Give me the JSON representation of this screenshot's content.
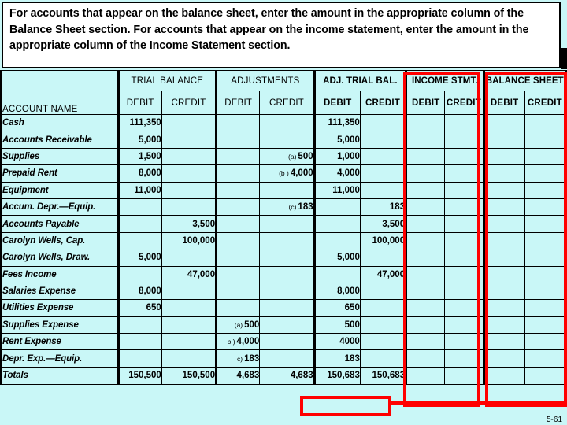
{
  "banner": {
    "text": "For accounts that appear on the balance sheet, enter the amount in the appropriate column of the Balance Sheet section. For accounts that appear on the income statement, enter the amount in the appropriate column of the Income Statement section."
  },
  "worksheet": {
    "account_name_header": "ACCOUNT NAME",
    "groups": [
      {
        "label": "TRIAL BALANCE",
        "bold": false
      },
      {
        "label": "ADJUSTMENTS",
        "bold": false
      },
      {
        "label": "ADJ. TRIAL BAL.",
        "bold": true
      },
      {
        "label": "INCOME STMT.",
        "bold": true
      },
      {
        "label": "BALANCE SHEET",
        "bold": true
      }
    ],
    "sub_headers": {
      "debit": "DEBIT",
      "credit": "CREDIT"
    },
    "rows": [
      {
        "account": "Cash",
        "tb_debit": "111,350",
        "tb_credit": "",
        "adj_debit": "",
        "adj_debit_ref": "",
        "adj_credit": "",
        "adj_credit_ref": "",
        "atb_debit": "111,350",
        "atb_credit": "",
        "is_debit": "",
        "is_credit": "",
        "bs_debit": "",
        "bs_credit": ""
      },
      {
        "account": "Accounts Receivable",
        "tb_debit": "5,000",
        "tb_credit": "",
        "adj_debit": "",
        "adj_debit_ref": "",
        "adj_credit": "",
        "adj_credit_ref": "",
        "atb_debit": "5,000",
        "atb_credit": "",
        "is_debit": "",
        "is_credit": "",
        "bs_debit": "",
        "bs_credit": ""
      },
      {
        "account": "Supplies",
        "tb_debit": "1,500",
        "tb_credit": "",
        "adj_debit": "",
        "adj_debit_ref": "",
        "adj_credit": "500",
        "adj_credit_ref": "(a)",
        "atb_debit": "1,000",
        "atb_credit": "",
        "is_debit": "",
        "is_credit": "",
        "bs_debit": "",
        "bs_credit": ""
      },
      {
        "account": "Prepaid Rent",
        "tb_debit": "8,000",
        "tb_credit": "",
        "adj_debit": "",
        "adj_debit_ref": "",
        "adj_credit": "4,000",
        "adj_credit_ref": "(b )",
        "atb_debit": "4,000",
        "atb_credit": "",
        "is_debit": "",
        "is_credit": "",
        "bs_debit": "",
        "bs_credit": ""
      },
      {
        "account": "Equipment",
        "tb_debit": "11,000",
        "tb_credit": "",
        "adj_debit": "",
        "adj_debit_ref": "",
        "adj_credit": "",
        "adj_credit_ref": "",
        "atb_debit": "11,000",
        "atb_credit": "",
        "is_debit": "",
        "is_credit": "",
        "bs_debit": "",
        "bs_credit": ""
      },
      {
        "account": "Accum. Depr.—Equip.",
        "tb_debit": "",
        "tb_credit": "",
        "adj_debit": "",
        "adj_debit_ref": "",
        "adj_credit": "183",
        "adj_credit_ref": "(c)",
        "atb_debit": "",
        "atb_credit": "183",
        "is_debit": "",
        "is_credit": "",
        "bs_debit": "",
        "bs_credit": ""
      },
      {
        "account": "Accounts Payable",
        "tb_debit": "",
        "tb_credit": "3,500",
        "adj_debit": "",
        "adj_debit_ref": "",
        "adj_credit": "",
        "adj_credit_ref": "",
        "atb_debit": "",
        "atb_credit": "3,500",
        "is_debit": "",
        "is_credit": "",
        "bs_debit": "",
        "bs_credit": ""
      },
      {
        "account": "Carolyn Wells, Cap.",
        "tb_debit": "",
        "tb_credit": "100,000",
        "adj_debit": "",
        "adj_debit_ref": "",
        "adj_credit": "",
        "adj_credit_ref": "",
        "atb_debit": "",
        "atb_credit": "100,000",
        "is_debit": "",
        "is_credit": "",
        "bs_debit": "",
        "bs_credit": ""
      },
      {
        "account": "Carolyn Wells, Draw.",
        "tb_debit": "5,000",
        "tb_credit": "",
        "adj_debit": "",
        "adj_debit_ref": "",
        "adj_credit": "",
        "adj_credit_ref": "",
        "atb_debit": "5,000",
        "atb_credit": "",
        "is_debit": "",
        "is_credit": "",
        "bs_debit": "",
        "bs_credit": ""
      },
      {
        "account": "Fees Income",
        "tb_debit": "",
        "tb_credit": "47,000",
        "adj_debit": "",
        "adj_debit_ref": "",
        "adj_credit": "",
        "adj_credit_ref": "",
        "atb_debit": "",
        "atb_credit": "47,000",
        "is_debit": "",
        "is_credit": "",
        "bs_debit": "",
        "bs_credit": ""
      },
      {
        "account": "Salaries Expense",
        "tb_debit": "8,000",
        "tb_credit": "",
        "adj_debit": "",
        "adj_debit_ref": "",
        "adj_credit": "",
        "adj_credit_ref": "",
        "atb_debit": "8,000",
        "atb_credit": "",
        "is_debit": "",
        "is_credit": "",
        "bs_debit": "",
        "bs_credit": ""
      },
      {
        "account": "Utilities Expense",
        "tb_debit": "650",
        "tb_credit": "",
        "adj_debit": "",
        "adj_debit_ref": "",
        "adj_credit": "",
        "adj_credit_ref": "",
        "atb_debit": "650",
        "atb_credit": "",
        "is_debit": "",
        "is_credit": "",
        "bs_debit": "",
        "bs_credit": ""
      },
      {
        "account": "Supplies Expense",
        "tb_debit": "",
        "tb_credit": "",
        "adj_debit": "500",
        "adj_debit_ref": "(a)",
        "adj_credit": "",
        "adj_credit_ref": "",
        "atb_debit": "500",
        "atb_credit": "",
        "is_debit": "",
        "is_credit": "",
        "bs_debit": "",
        "bs_credit": ""
      },
      {
        "account": "Rent Expense",
        "tb_debit": "",
        "tb_credit": "",
        "adj_debit": "4,000",
        "adj_debit_ref": "b )",
        "adj_credit": "",
        "adj_credit_ref": "",
        "atb_debit": "4000",
        "atb_credit": "",
        "is_debit": "",
        "is_credit": "",
        "bs_debit": "",
        "bs_credit": ""
      },
      {
        "account": "Depr. Exp.—Equip.",
        "tb_debit": "",
        "tb_credit": "",
        "adj_debit": "183",
        "adj_debit_ref": "c)",
        "adj_credit": "",
        "adj_credit_ref": "",
        "atb_debit": "183",
        "atb_credit": "",
        "is_debit": "",
        "is_credit": "",
        "bs_debit": "",
        "bs_credit": ""
      },
      {
        "account": "Totals",
        "tb_debit": "150,500",
        "tb_credit": "150,500",
        "adj_debit": "4,683",
        "adj_debit_ref": "",
        "adj_credit": "4,683",
        "adj_credit_ref": "",
        "atb_debit": "150,683",
        "atb_credit": "150,683",
        "is_debit": "",
        "is_credit": "",
        "bs_debit": "",
        "bs_credit": ""
      }
    ]
  },
  "footer": {
    "page_number": "5-61"
  },
  "colors": {
    "sheet_background": "#c9f7f7",
    "highlight": "#ff0000",
    "banner_background": "#ffffff",
    "rule": "#000000"
  }
}
